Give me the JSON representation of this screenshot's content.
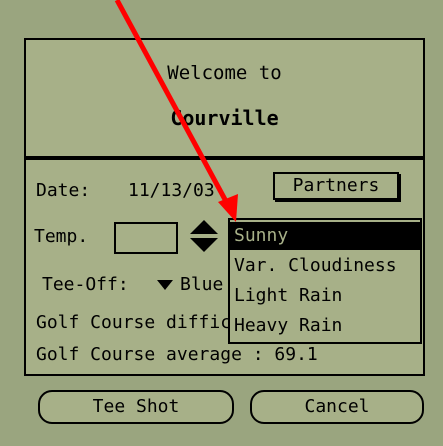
{
  "header": {
    "welcome": "Welcome to",
    "course_name": "Courville"
  },
  "form": {
    "date_label": "Date:",
    "date_value": "11/13/03",
    "partners_button": "Partners",
    "temp_label": "Temp.",
    "temp_value": "",
    "tee_off_label": "Tee-Off:",
    "tee_off_value": "Blue",
    "difficulty_label": "Golf Course difficu",
    "average_label": "Golf Course average : 69.1"
  },
  "weather_dropdown": {
    "options": [
      "Sunny",
      "Var. Cloudiness",
      "Light Rain",
      "Heavy Rain"
    ],
    "selected": "Sunny"
  },
  "buttons": {
    "tee_shot": "Tee Shot",
    "cancel": "Cancel"
  },
  "colors": {
    "screen_background": "#9aa57f",
    "panel_background": "#a7b088",
    "ink": "#000000",
    "annotation_arrow": "#ff0000"
  },
  "icons": [
    "temperature-up-icon",
    "temperature-down-icon",
    "tee-off-dropdown-caret-icon",
    "annotation-arrow-icon"
  ]
}
